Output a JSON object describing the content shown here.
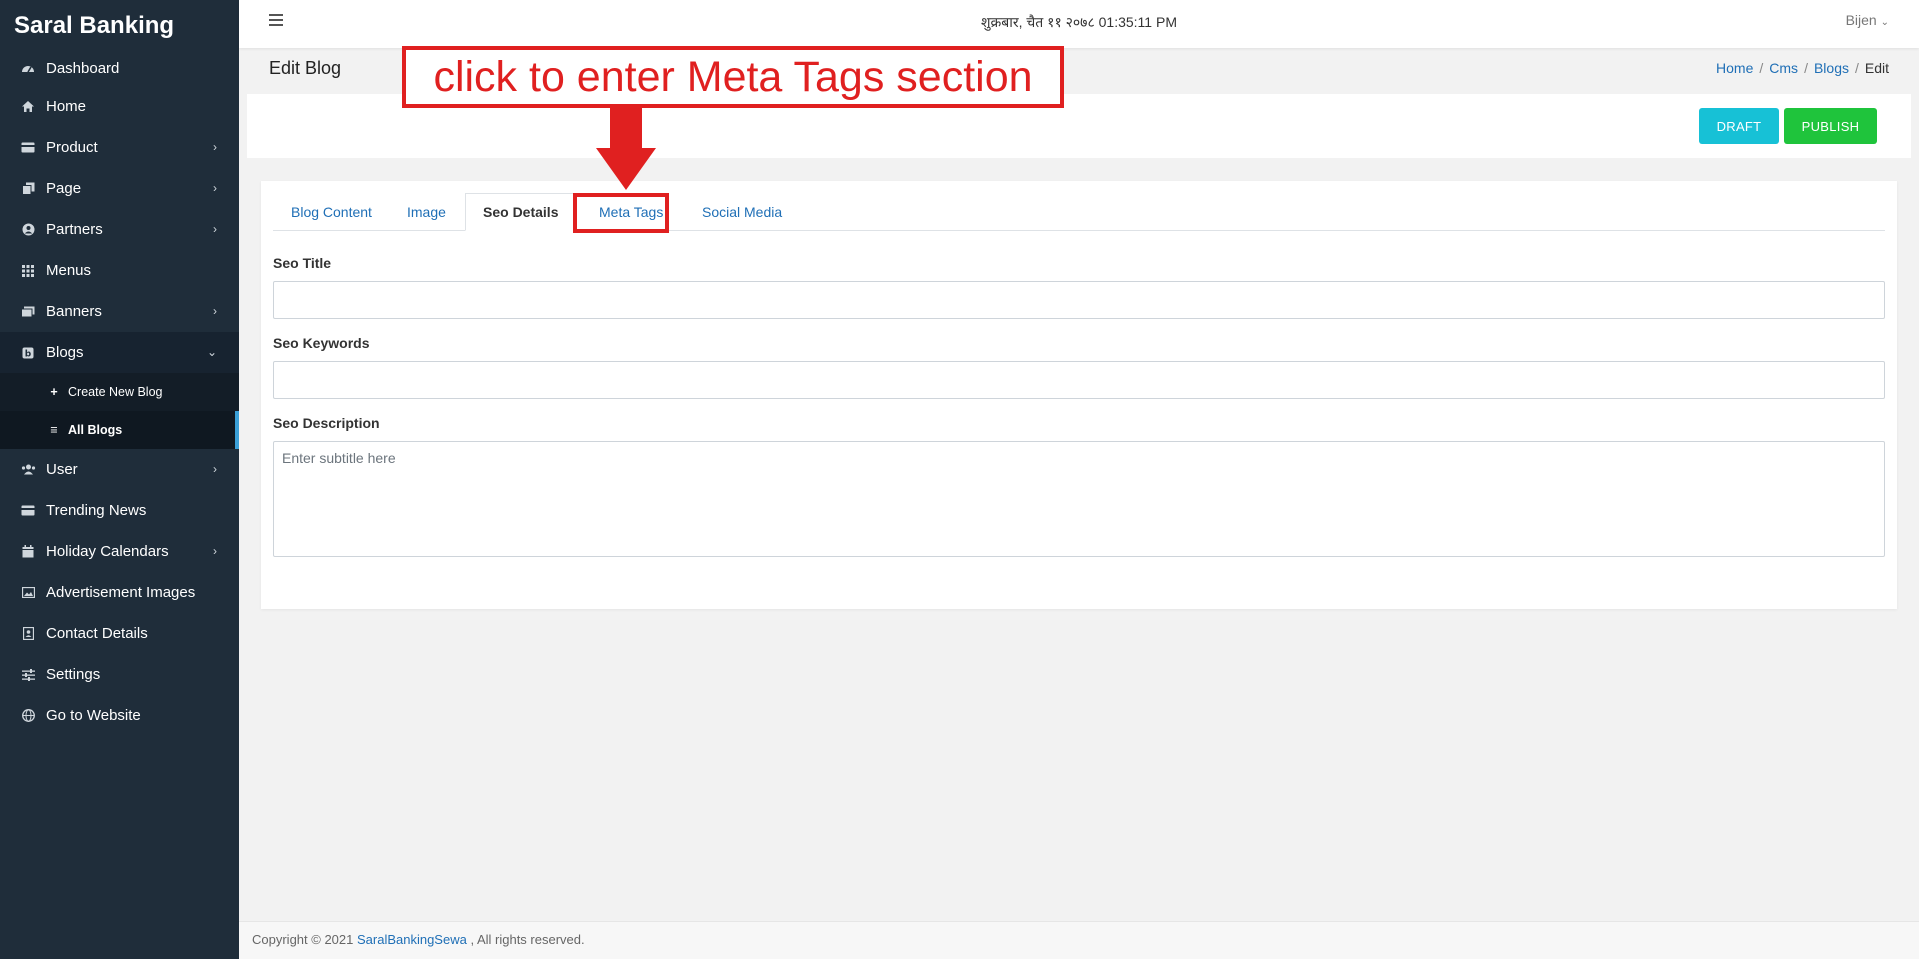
{
  "sidebar": {
    "brand": "Saral Banking",
    "items": [
      {
        "label": "Dashboard",
        "icon": "dashboard-icon"
      },
      {
        "label": "Home",
        "icon": "home-icon"
      },
      {
        "label": "Product",
        "icon": "card-icon"
      },
      {
        "label": "Page",
        "icon": "copy-icon"
      },
      {
        "label": "Partners",
        "icon": "user-circle-icon"
      },
      {
        "label": "Menus",
        "icon": "grid-icon"
      },
      {
        "label": "Banners",
        "icon": "images-icon"
      },
      {
        "label": "Blogs",
        "icon": "blog-icon"
      },
      {
        "label": "User",
        "icon": "users-icon"
      },
      {
        "label": "Trending News",
        "icon": "card-icon"
      },
      {
        "label": "Holiday Calendars",
        "icon": "calendar-icon"
      },
      {
        "label": "Advertisement Images",
        "icon": "image-icon"
      },
      {
        "label": "Contact Details",
        "icon": "contact-icon"
      },
      {
        "label": "Settings",
        "icon": "sliders-icon"
      },
      {
        "label": "Go to Website",
        "icon": "globe-icon"
      }
    ],
    "blogs_sub": [
      {
        "label": "Create New Blog",
        "icon": "plus-icon"
      },
      {
        "label": "All Blogs",
        "icon": "list-icon"
      }
    ]
  },
  "topbar": {
    "datetime": "शुक्रबार, चैत ११ २०७८ 01:35:11 PM",
    "user": "Bijen"
  },
  "page": {
    "title": "Edit Blog",
    "breadcrumb": [
      "Home",
      "Cms",
      "Blogs",
      "Edit"
    ]
  },
  "actions": {
    "draft": "DRAFT",
    "publish": "PUBLISH"
  },
  "tabs": [
    "Blog Content",
    "Image",
    "Seo Details",
    "Meta Tags",
    "Social Media"
  ],
  "active_tab": "Seo Details",
  "form": {
    "seo_title_label": "Seo Title",
    "seo_title_value": "",
    "seo_keywords_label": "Seo Keywords",
    "seo_keywords_value": "",
    "seo_description_label": "Seo Description",
    "seo_description_placeholder": "Enter subtitle here"
  },
  "annotation": {
    "text": "click to enter Meta Tags section",
    "color": "#e02020"
  },
  "footer": {
    "prefix": "Copyright © 2021 ",
    "link": "SaralBankingSewa",
    "suffix": " , All rights reserved."
  },
  "colors": {
    "sidebar_bg": "#1f2d3a",
    "link": "#1f6fb6",
    "draft": "#17c1d6",
    "publish": "#1fc43c",
    "active_indicator": "#3ba0d8"
  }
}
